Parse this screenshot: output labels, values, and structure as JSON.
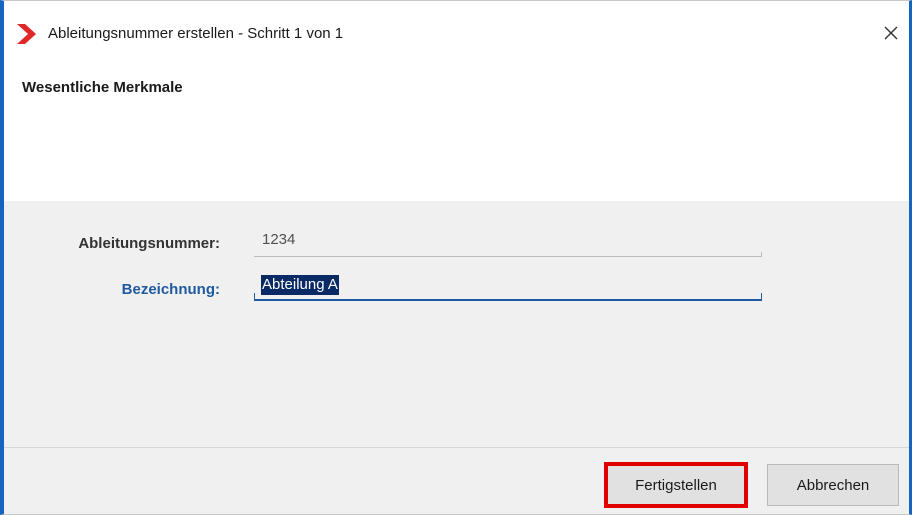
{
  "window": {
    "title": "Ableitungsnummer erstellen - Schritt 1 von 1",
    "logo_icon": "red-chevron-logo",
    "close_icon": "close-icon"
  },
  "header": {
    "section_heading": "Wesentliche Merkmale"
  },
  "form": {
    "ableitungsnummer_label": "Ableitungsnummer:",
    "ableitungsnummer_value": "1234",
    "bezeichnung_label": "Bezeichnung:",
    "bezeichnung_value": "Abteilung A"
  },
  "footer": {
    "finish_label": "Fertigstellen",
    "cancel_label": "Abbrechen"
  },
  "colors": {
    "accent_blue": "#1f5aa0",
    "window_border": "#1565c0",
    "logo_red": "#e0282a",
    "highlight_red": "#e00000",
    "selection_bg": "#0a2a66"
  }
}
